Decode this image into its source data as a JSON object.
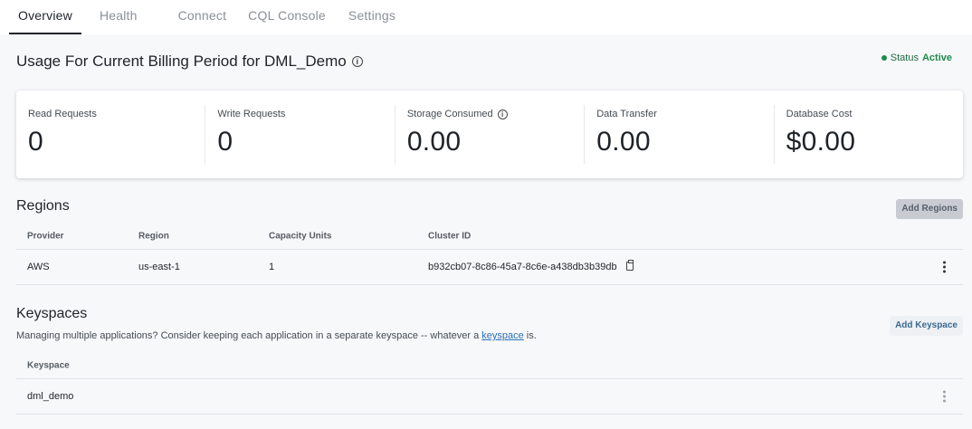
{
  "tabs": [
    {
      "label": "Overview",
      "active": true
    },
    {
      "label": "Health",
      "active": false
    },
    {
      "label": "Connect",
      "active": false
    },
    {
      "label": "CQL Console",
      "active": false
    },
    {
      "label": "Settings",
      "active": false
    }
  ],
  "header": {
    "title": "Usage For Current Billing Period for DML_Demo",
    "status_label": "Status",
    "status_value": "Active"
  },
  "metrics": [
    {
      "label": "Read Requests",
      "value": "0",
      "has_info": false
    },
    {
      "label": "Write Requests",
      "value": "0",
      "has_info": false
    },
    {
      "label": "Storage Consumed",
      "value": "0.00",
      "has_info": true
    },
    {
      "label": "Data Transfer",
      "value": "0.00",
      "has_info": false
    },
    {
      "label": "Database Cost",
      "value": "$0.00",
      "has_info": false
    }
  ],
  "regions": {
    "title": "Regions",
    "add_button": "Add Regions",
    "columns": [
      "Provider",
      "Region",
      "Capacity Units",
      "Cluster ID"
    ],
    "rows": [
      {
        "provider": "AWS",
        "region": "us-east-1",
        "capacity_units": "1",
        "cluster_id": "b932cb07-8c86-45a7-8c6e-a438db3b39db"
      }
    ]
  },
  "keyspaces": {
    "title": "Keyspaces",
    "add_button": "Add Keyspace",
    "description_prefix": "Managing multiple applications? Consider keeping each application in a separate keyspace -- whatever a ",
    "description_link": "keyspace",
    "description_suffix": " is.",
    "columns": [
      "Keyspace"
    ],
    "rows": [
      {
        "name": "dml_demo"
      }
    ]
  },
  "colors": {
    "status_active": "#1f8a4c",
    "link": "#2d6fb3",
    "accent_button": "#3a6a92"
  },
  "icons": [
    "info-icon",
    "copy-icon",
    "kebab-menu-icon",
    "status-dot-icon"
  ]
}
